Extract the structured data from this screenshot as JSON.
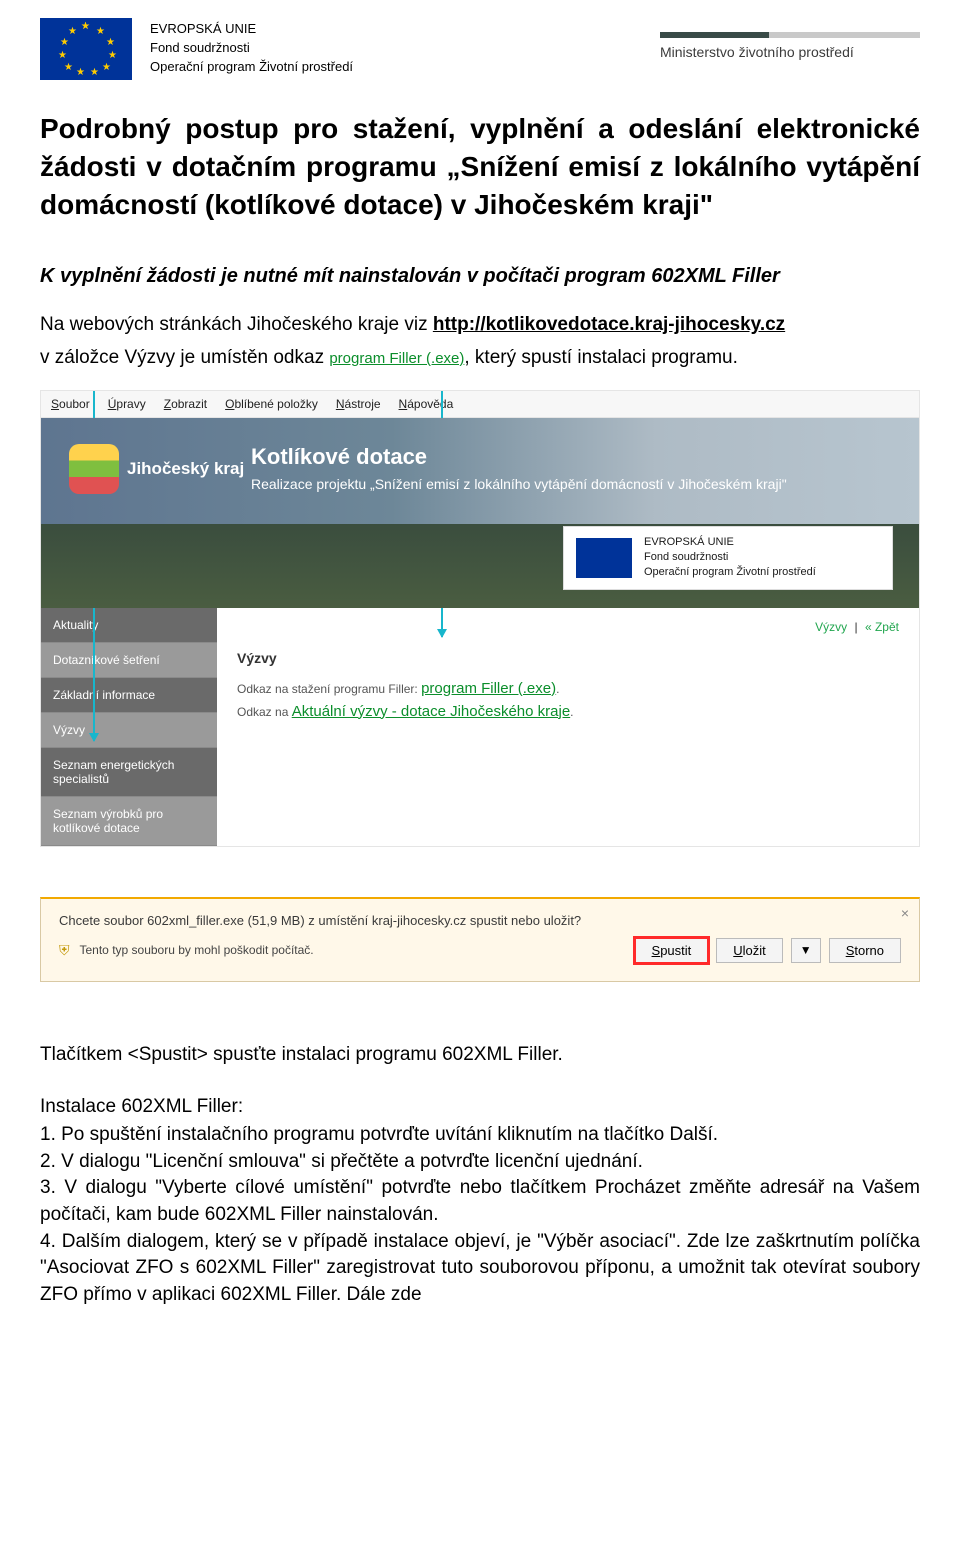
{
  "header": {
    "eu_l1": "EVROPSKÁ UNIE",
    "eu_l2": "Fond soudržnosti",
    "eu_l3": "Operační program Životní prostředí",
    "mzp": "Ministerstvo životního prostředí"
  },
  "doc": {
    "title": "Podrobný postup pro stažení, vyplnění a odeslání elektronické žádosti v dotačním programu „Snížení emisí z lokálního vytápění domácností (kotlíkové dotace) v Jihočeském kraji\"",
    "subtitle": "K vyplnění žádosti je nutné mít nainstalován v počítači program 602XML Filler",
    "p1_a": "Na webových stránkách Jihočeského kraje viz ",
    "p1_link": "http://kotlikovedotace.kraj-jihocesky.cz",
    "p2_a": "v záložce Výzvy je umístěn odkaz ",
    "p2_inline": "program Filler (.exe)",
    "p2_b": ", který spustí instalaci programu.",
    "after_shot": "Tlačítkem <Spustit> spusťte instalaci programu 602XML Filler.",
    "install_title": "Instalace 602XML Filler:",
    "steps": [
      "1. Po spuštění instalačního programu potvrďte uvítání kliknutím na tlačítko Další.",
      "2. V dialogu \"Licenční smlouva\" si přečtěte a potvrďte licenční ujednání.",
      "3. V dialogu \"Vyberte cílové umístění\" potvrďte nebo tlačítkem Procházet změňte adresář na Vašem počítači, kam bude 602XML Filler nainstalován."
    ],
    "after_steps": "4. Dalším dialogem, který se v případě instalace objeví, je \"Výběr asociací\". Zde lze zaškrtnutím políčka \"Asociovat ZFO s 602XML Filler\" zaregistrovat tuto souborovou příponu, a umožnit tak otevírat soubory ZFO přímo v aplikaci 602XML Filler. Dále zde"
  },
  "shot": {
    "menu": [
      "Soubor",
      "Úpravy",
      "Zobrazit",
      "Oblíbené položky",
      "Nástroje",
      "Nápověda"
    ],
    "region": "Jihočeský kraj",
    "banner_title": "Kotlíkové dotace",
    "banner_sub": "Realizace projektu „Snížení emisí z lokálního vytápění domácností v Jihočeském kraji\"",
    "eu_l1": "EVROPSKÁ UNIE",
    "eu_l2": "Fond soudržnosti",
    "eu_l3": "Operační program Životní prostředí",
    "breadcrumb_link": "Výzvy",
    "breadcrumb_sep": "|",
    "breadcrumb_back": "« Zpět",
    "content_h": "Výzvy",
    "c_line1_a": "Odkaz na stažení programu Filler: ",
    "c_line1_link": "program Filler (.exe)",
    "c_line2_a": "Odkaz na ",
    "c_line2_link": "Aktuální výzvy - dotace Jihočeského kraje",
    "sidebar": [
      "Aktuality",
      "Dotazníkové šetření",
      "Základní informace",
      "Výzvy",
      "Seznam energetických specialistů",
      "Seznam výrobků pro kotlíkové dotace"
    ]
  },
  "dl": {
    "q": "Chcete soubor 602xml_filler.exe (51,9 MB) z umístění kraj-jihocesky.cz spustit nebo uložit?",
    "warn": "Tento typ souboru by mohl poškodit počítač.",
    "btn_spustit": "Spustit",
    "btn_ulozit": "Uložit",
    "btn_storno": "Storno"
  }
}
